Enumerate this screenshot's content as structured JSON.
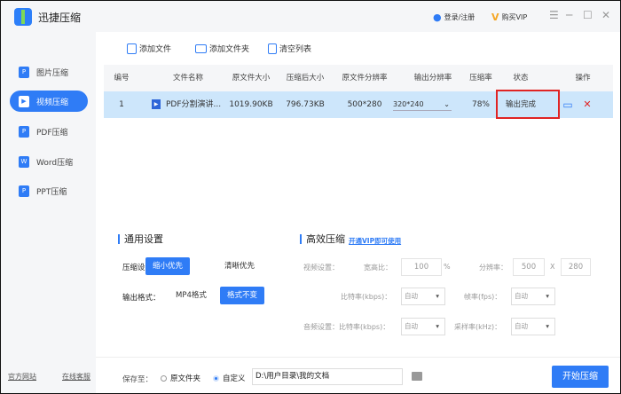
{
  "app": {
    "title": "迅捷压缩",
    "login": "登录/注册",
    "vip": "购买VIP"
  },
  "sidebar": {
    "items": [
      {
        "label": "图片压缩",
        "icon": "P"
      },
      {
        "label": "视频压缩",
        "icon": "▶"
      },
      {
        "label": "PDF压缩",
        "icon": "P"
      },
      {
        "label": "Word压缩",
        "icon": "W"
      },
      {
        "label": "PPT压缩",
        "icon": "P"
      }
    ],
    "footer_left": "官方网站",
    "footer_right": "在线客服"
  },
  "toolbar": {
    "add_file": "添加文件",
    "add_folder": "添加文件夹",
    "clear": "清空列表"
  },
  "table": {
    "headers": [
      "编号",
      "文件名称",
      "原文件大小",
      "压缩后大小",
      "原文件分辨率",
      "输出分辨率",
      "压缩率",
      "状态",
      "操作"
    ],
    "row": {
      "index": "1",
      "name": "PDF分割演讲...",
      "orig_size": "1019.90KB",
      "comp_size": "796.73KB",
      "orig_res": "500*280",
      "out_res": "320*240",
      "rate": "78%",
      "status": "输出完成"
    }
  },
  "general": {
    "title": "通用设置",
    "compress_label": "压缩设置：",
    "opt_small": "缩小优先",
    "opt_clear": "清晰优先",
    "format_label": "输出格式：",
    "fmt_mp4": "MP4格式",
    "fmt_keep": "格式不变"
  },
  "advanced": {
    "title": "高效压缩",
    "vip_link": "开通VIP即可使用",
    "video_label": "视频设置：",
    "ratio_label": "宽高比：",
    "ratio": "100",
    "pct": "%",
    "res_label": "分辨率：",
    "res_w": "500",
    "x": "X",
    "res_h": "280",
    "bitrate_label": "比特率(kbps)：",
    "bitrate": "自动",
    "fps_label": "帧率(fps)：",
    "fps": "自动",
    "audio_label": "音频设置：比特率(kbps)：",
    "audio_bitrate": "自动",
    "sample_label": "采样率(kHz)：",
    "sample": "自动"
  },
  "footer": {
    "save_label": "保存至：",
    "orig_folder": "原文件夹",
    "custom": "自定义",
    "path": "D:\\用户目录\\我的文档",
    "start": "开始压缩"
  },
  "colors": {
    "accent": "#2f7cf6",
    "selected_row": "#cde6fb",
    "highlight": "#e02424"
  }
}
